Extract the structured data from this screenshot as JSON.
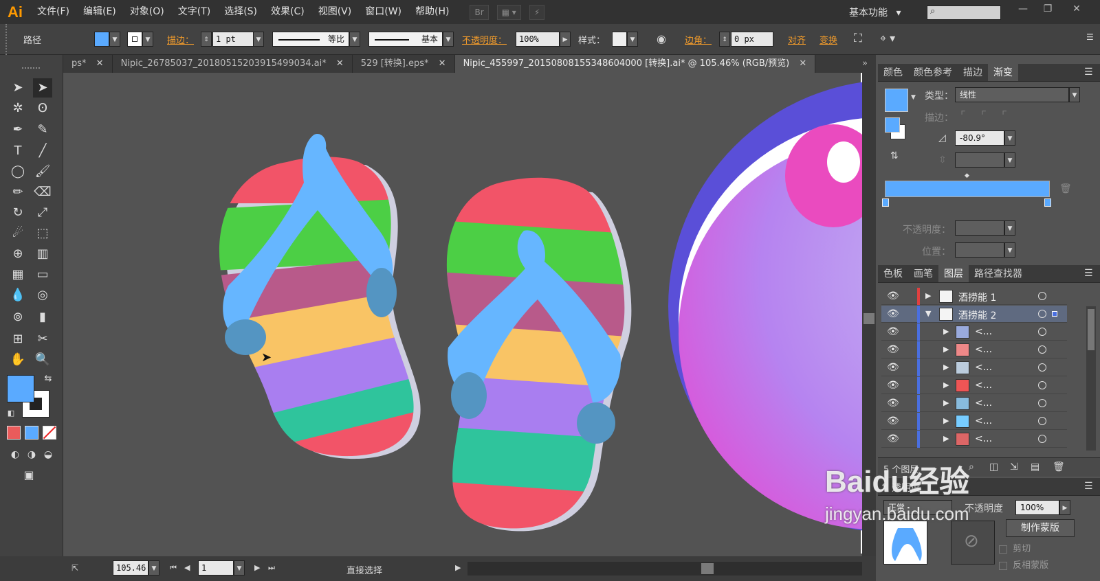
{
  "app": {
    "logo": "Ai",
    "workspace": "基本功能",
    "workspace_caret": "▾",
    "bridge": "Br"
  },
  "menu": [
    "文件(F)",
    "编辑(E)",
    "对象(O)",
    "文字(T)",
    "选择(S)",
    "效果(C)",
    "视图(V)",
    "窗口(W)",
    "帮助(H)"
  ],
  "window_controls": [
    "—",
    "❐",
    "✕"
  ],
  "control_bar": {
    "selection_type": "路径",
    "stroke_label": "描边：",
    "stroke_weight": "1 pt",
    "stroke_profile": "等比",
    "brush": "基本",
    "opacity_label": "不透明度：",
    "opacity_value": "100%",
    "style_label": "样式：",
    "corner_label": "边角：",
    "corner_value": "0 px",
    "align_label": "对齐",
    "transform_label": "变换",
    "fill_color": "#5aaaff"
  },
  "tabs": [
    {
      "label": "ps*",
      "close": "✕"
    },
    {
      "label": "Nipic_26785037_20180515203915499034.ai*",
      "close": "✕"
    },
    {
      "label": "529 [转换].eps*",
      "close": "✕"
    },
    {
      "label": "Nipic_455997_20150808155348604000 [转换].ai* @ 105.46% (RGB/预览)",
      "close": "✕"
    }
  ],
  "tabs_overflow": "»",
  "gradient_panel": {
    "tabs": [
      "颜色",
      "颜色参考",
      "描边",
      "渐变"
    ],
    "active_tab": "渐变",
    "type_label": "类型：",
    "type_value": "线性",
    "stroke_label": "描边：",
    "angle_value": "-80.9°",
    "opacity_label": "不透明度：",
    "position_label": "位置：",
    "gradient_color": "#5aaaff"
  },
  "layers_panel": {
    "tabs": [
      "色板",
      "画笔",
      "图层",
      "路径查找器"
    ],
    "active_tab": "图层",
    "layers": [
      {
        "name": "酒捞能 1",
        "level": 0,
        "expanded": false
      },
      {
        "name": "酒捞能 2",
        "level": 0,
        "expanded": true
      },
      {
        "name": "<...",
        "level": 1
      },
      {
        "name": "<...",
        "level": 1
      },
      {
        "name": "<...",
        "level": 1
      },
      {
        "name": "<...",
        "level": 1
      },
      {
        "name": "<...",
        "level": 1
      },
      {
        "name": "<...",
        "level": 1
      },
      {
        "name": "<...",
        "level": 1
      }
    ],
    "count_label": "5 个图层"
  },
  "transparency_panel": {
    "title": "透明度",
    "mode": "正常",
    "opacity_label": "不透明度",
    "opacity_value": "100%",
    "make_mask": "制作蒙版",
    "clip": "剪切",
    "invert_mask": "反相蒙版"
  },
  "status_bar": {
    "zoom": "105.46",
    "page": "1",
    "tool_name": "直接选择"
  },
  "watermark": {
    "brand": "Baidu经验",
    "url": "jingyan.baidu.com"
  }
}
